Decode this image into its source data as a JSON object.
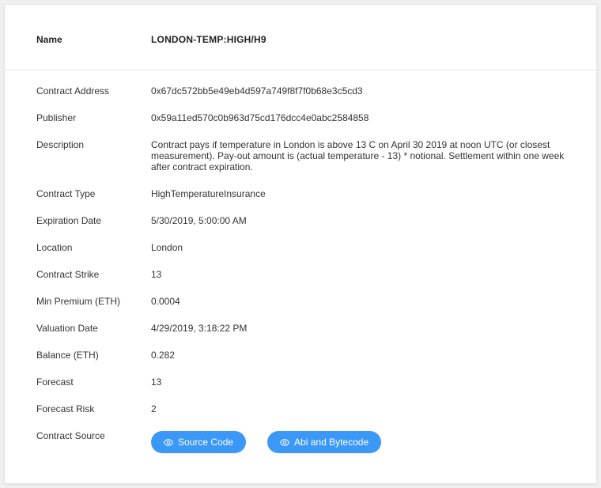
{
  "header": {
    "name_label": "Name",
    "name_value": "LONDON-TEMP:HIGH/H9"
  },
  "fields": {
    "contract_address": {
      "label": "Contract Address",
      "value": "0x67dc572bb5e49eb4d597a749f8f7f0b68e3c5cd3"
    },
    "publisher": {
      "label": "Publisher",
      "value": "0x59a11ed570c0b963d75cd176dcc4e0abc2584858"
    },
    "description": {
      "label": "Description",
      "value": "Contract pays if temperature in London is above 13 C on April 30 2019 at noon UTC (or closest measurement). Pay-out amount is (actual temperature - 13) * notional. Settlement within one week after contract expiration."
    },
    "contract_type": {
      "label": "Contract Type",
      "value": "HighTemperatureInsurance"
    },
    "expiration_date": {
      "label": "Expiration Date",
      "value": "5/30/2019, 5:00:00 AM"
    },
    "location": {
      "label": "Location",
      "value": "London"
    },
    "contract_strike": {
      "label": "Contract Strike",
      "value": "13"
    },
    "min_premium": {
      "label": "Min Premium (ETH)",
      "value": "0.0004"
    },
    "valuation_date": {
      "label": "Valuation Date",
      "value": "4/29/2019, 3:18:22 PM"
    },
    "balance": {
      "label": "Balance (ETH)",
      "value": "0.282"
    },
    "forecast": {
      "label": "Forecast",
      "value": "13"
    },
    "forecast_risk": {
      "label": "Forecast Risk",
      "value": "2"
    },
    "contract_source": {
      "label": "Contract Source"
    }
  },
  "buttons": {
    "source_code": {
      "label": "Source Code",
      "icon": "eye-icon"
    },
    "abi_bytecode": {
      "label": "Abi and Bytecode",
      "icon": "eye-icon"
    }
  },
  "colors": {
    "button_bg": "#3c98f6",
    "card_bg": "#ffffff",
    "page_bg": "#f0f0f0"
  }
}
